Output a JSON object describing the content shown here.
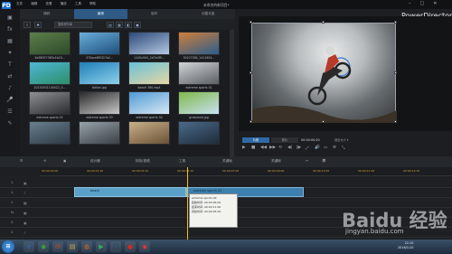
{
  "titlebar": {
    "logo": "PD",
    "menu": [
      "文件",
      "编辑",
      "查看",
      "播放",
      "工具",
      "帮助"
    ],
    "title": "未命名的新项目*",
    "minimize": "–",
    "maximize": "□",
    "close": "✕"
  },
  "brand": "PowerDirector",
  "sidebar": {
    "icons": [
      "media-icon",
      "fx-icon",
      "pip-icon",
      "particle-icon",
      "title-icon",
      "transition-icon",
      "audio-icon",
      "voice-icon",
      "chapter-icon",
      "subtitle-icon"
    ],
    "glyphs": [
      "▣",
      "fx",
      "▦",
      "✦",
      "T",
      "⇄",
      "♪",
      "🎤",
      "☰",
      "✎"
    ]
  },
  "library": {
    "tabs": [
      "捕获",
      "编辑",
      "制作",
      "创建光盘"
    ],
    "active_tab": 1,
    "search_placeholder": "搜索资料库",
    "tool_glyphs": [
      "▤",
      "▦",
      "◧",
      "▣"
    ],
    "tiles": [
      {
        "caption": "3a58f2f7365e1b20...",
        "colors": [
          "#5d7f4b",
          "#2e4a2a"
        ]
      },
      {
        "caption": "370ace8f5327a2...",
        "colors": [
          "#6aaedb",
          "#1d4f7a"
        ]
      },
      {
        "caption": "1440x900_2d7e4f9...",
        "colors": [
          "#2c4876",
          "#b4c9e4"
        ]
      },
      {
        "caption": "30107284_1411654...",
        "colors": [
          "#d07f3a",
          "#2b5d8c"
        ]
      },
      {
        "caption": "20130531140022_5...",
        "colors": [
          "#4fb6d6",
          "#2c8f6a"
        ]
      },
      {
        "caption": "ballon.jpg",
        "colors": [
          "#1e7fb8",
          "#8fd0ea"
        ]
      },
      {
        "caption": "beach 360.mp4",
        "colors": [
          "#68c1d9",
          "#e6d6a4"
        ]
      },
      {
        "caption": "extreme sports 01",
        "colors": [
          "#d2d5d8",
          "#5a5f64"
        ]
      },
      {
        "caption": "extreme sports 02",
        "colors": [
          "#8f8f94",
          "#2a2c2f"
        ]
      },
      {
        "caption": "extreme sports 03",
        "colors": [
          "#2a2a2a",
          "#c8c8c8"
        ]
      },
      {
        "caption": "extreme sports 04",
        "colors": [
          "#4f9ad4",
          "#d8e8f4"
        ]
      },
      {
        "caption": "grassland.jpg",
        "colors": [
          "#7fb84a",
          "#c9e1f2"
        ]
      },
      {
        "caption": "",
        "colors": [
          "#6a7f8e",
          "#2c3a44"
        ]
      },
      {
        "caption": "",
        "colors": [
          "#98a2aa",
          "#3a4046"
        ]
      },
      {
        "caption": "",
        "colors": [
          "#c9b08a",
          "#6a5236"
        ]
      },
      {
        "caption": "",
        "colors": [
          "#4a6a8a",
          "#1e2c3a"
        ]
      }
    ]
  },
  "preview": {
    "mode_clip": "片段",
    "mode_movie": "影片",
    "timecode": "00:00:00.00",
    "quality": "适合大小 ▾",
    "controls": [
      "▶",
      "■",
      "◀◀",
      "▶▶",
      "⟲",
      "◀|",
      "|▶",
      "⤢",
      "🔊",
      "▭",
      "⚙",
      "⤡"
    ]
  },
  "timeline_toolbar": {
    "items": [
      "设计器",
      "特效/视频",
      "工具",
      "关键帧",
      "关键帧"
    ],
    "icons": [
      "☰",
      "⟲",
      "▣",
      "✂",
      "🎬",
      "▦",
      "⌘"
    ]
  },
  "ruler": {
    "ticks": [
      "00:00:00:00",
      "00:00:01:20",
      "00:00:03:15",
      "00:00:05:10",
      "00:00:07:05",
      "00:00:09:00",
      "00:00:10:25",
      "00:00:12:20",
      "00:00:14:15"
    ]
  },
  "tracks": [
    {
      "label": "1.",
      "icon": "▣"
    },
    {
      "label": "1.",
      "icon": "♪"
    },
    {
      "label": "1.",
      "icon": "▦"
    },
    {
      "label": "fx",
      "icon": "▣"
    },
    {
      "label": "2.",
      "icon": "▣"
    },
    {
      "label": "2.",
      "icon": "♪"
    }
  ],
  "clips": {
    "clip1": "beach",
    "clip2": "extreme sports 02"
  },
  "tooltip": {
    "name": "extreme sports 02",
    "start": "起始时间: 00:00:06:00",
    "end": "结束时间: 00:00:11:00",
    "dur": "持续时间: 00:00:05:00"
  },
  "taskbar": {
    "start": "⊞",
    "apps": [
      {
        "g": "e",
        "c": "#2a6fc8"
      },
      {
        "g": "◉",
        "c": "#3aa83a"
      },
      {
        "g": "✉",
        "c": "#d84a2a"
      },
      {
        "g": "▤",
        "c": "#d8a84a"
      },
      {
        "g": "◍",
        "c": "#e06a1a"
      },
      {
        "g": "▶",
        "c": "#3aa860"
      },
      {
        "g": "▢",
        "c": "#1a3a6a"
      },
      {
        "g": "●",
        "c": "#c82a2a"
      },
      {
        "g": "◉",
        "c": "#d83a3a"
      }
    ],
    "time": "22:10",
    "date": "2016/1/10"
  },
  "watermark": {
    "main": "Baidu 经验",
    "sub": "jingyan.baidu.com"
  }
}
